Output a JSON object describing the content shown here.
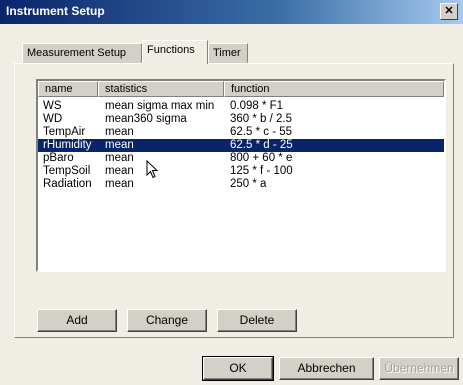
{
  "window": {
    "title": "Instrument Setup"
  },
  "tabs": [
    {
      "label": "Measurement Setup",
      "active": false
    },
    {
      "label": "Functions",
      "active": true
    },
    {
      "label": "Timer",
      "active": false
    }
  ],
  "list": {
    "columns": [
      "name",
      "statistics",
      "function"
    ],
    "rows": [
      {
        "name": "WS",
        "statistics": "mean sigma max min",
        "function": "0.098 * F1"
      },
      {
        "name": "WD",
        "statistics": "mean360 sigma",
        "function": "360 * b / 2.5"
      },
      {
        "name": "TempAir",
        "statistics": "mean",
        "function": "62.5 * c - 55"
      },
      {
        "name": "rHumidity",
        "statistics": "mean",
        "function": "62.5 * d - 25",
        "selected": true
      },
      {
        "name": "pBaro",
        "statistics": "mean",
        "function": "800 + 60 * e"
      },
      {
        "name": "TempSoil",
        "statistics": "mean",
        "function": "125 * f - 100"
      },
      {
        "name": "Radiation",
        "statistics": "mean",
        "function": "250 * a"
      }
    ]
  },
  "buttons": {
    "add": "Add",
    "change": "Change",
    "delete": "Delete"
  },
  "footer": {
    "ok": "OK",
    "cancel": "Abbrechen",
    "apply": "Übernehmen"
  }
}
